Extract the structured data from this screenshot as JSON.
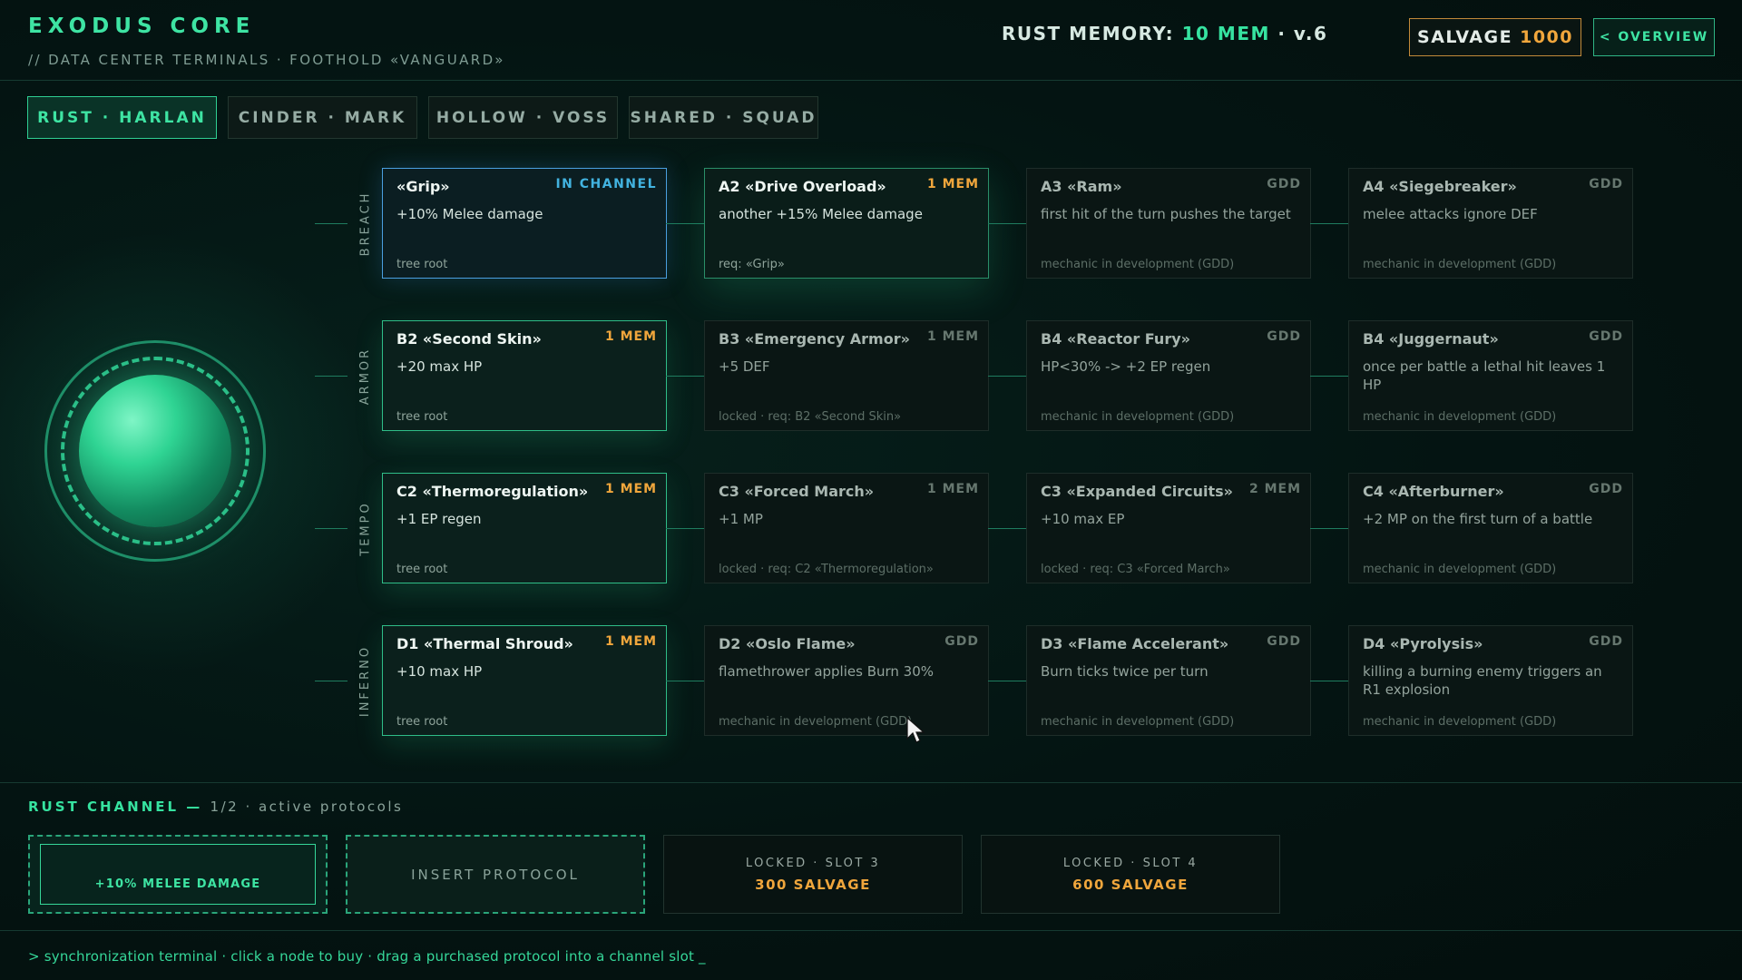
{
  "header": {
    "brand": "EXODUS CORE",
    "subtitle": "// DATA CENTER TERMINALS · FOOTHOLD «VANGUARD»",
    "memory_label": "RUST MEMORY:",
    "memory_value": "10 MEM",
    "version": "· v.6",
    "salvage_label": "SALVAGE",
    "salvage_value": "1000",
    "overview_label": "< OVERVIEW"
  },
  "tabs": [
    {
      "label": "RUST · HARLAN",
      "active": true
    },
    {
      "label": "CINDER · MARK",
      "active": false
    },
    {
      "label": "HOLLOW · VOSS",
      "active": false
    },
    {
      "label": "SHARED · SQUAD",
      "active": false
    }
  ],
  "branches": [
    {
      "label": "BREACH",
      "nodes": [
        {
          "title": "«Grip»",
          "badge": "IN CHANNEL",
          "desc": "+10% Melee damage",
          "foot": "tree root",
          "state": "channel"
        },
        {
          "title": "A2 «Drive Overload»",
          "badge": "1 MEM",
          "desc": "another +15% Melee damage",
          "foot": "req: «Grip»",
          "state": "available"
        },
        {
          "title": "A3 «Ram»",
          "badge": "GDD",
          "desc": "first hit of the turn pushes the target",
          "foot": "mechanic in development (GDD)",
          "state": "gdd"
        },
        {
          "title": "A4 «Siegebreaker»",
          "badge": "GDD",
          "desc": "melee attacks ignore DEF",
          "foot": "mechanic in development (GDD)",
          "state": "gdd"
        }
      ]
    },
    {
      "label": "ARMOR",
      "nodes": [
        {
          "title": "B2 «Second Skin»",
          "badge": "1 MEM",
          "desc": "+20 max HP",
          "foot": "tree root",
          "state": "owned"
        },
        {
          "title": "B3 «Emergency Armor»",
          "badge": "1 MEM",
          "desc": "+5 DEF",
          "foot": "locked · req: B2 «Second Skin»",
          "state": "locked"
        },
        {
          "title": "B4 «Reactor Fury»",
          "badge": "GDD",
          "desc": "HP<30% -> +2 EP regen",
          "foot": "mechanic in development (GDD)",
          "state": "gdd"
        },
        {
          "title": "B4 «Juggernaut»",
          "badge": "GDD",
          "desc": "once per battle a lethal hit leaves 1 HP",
          "foot": "mechanic in development (GDD)",
          "state": "gdd"
        }
      ]
    },
    {
      "label": "TEMPO",
      "nodes": [
        {
          "title": "C2 «Thermoregulation»",
          "badge": "1 MEM",
          "desc": "+1 EP regen",
          "foot": "tree root",
          "state": "owned"
        },
        {
          "title": "C3 «Forced March»",
          "badge": "1 MEM",
          "desc": "+1 MP",
          "foot": "locked · req: C2 «Thermoregulation»",
          "state": "locked"
        },
        {
          "title": "C3 «Expanded Circuits»",
          "badge": "2 MEM",
          "desc": "+10 max EP",
          "foot": "locked · req: C3 «Forced March»",
          "state": "locked"
        },
        {
          "title": "C4 «Afterburner»",
          "badge": "GDD",
          "desc": "+2 MP on the first turn of a battle",
          "foot": "mechanic in development (GDD)",
          "state": "gdd"
        }
      ]
    },
    {
      "label": "INFERNO",
      "nodes": [
        {
          "title": "D1 «Thermal Shroud»",
          "badge": "1 MEM",
          "desc": "+10 max HP",
          "foot": "tree root",
          "state": "owned"
        },
        {
          "title": "D2 «Oslo Flame»",
          "badge": "GDD",
          "desc": "flamethrower applies Burn 30%",
          "foot": "mechanic in development (GDD)",
          "state": "gdd"
        },
        {
          "title": "D3 «Flame Accelerant»",
          "badge": "GDD",
          "desc": "Burn ticks twice per turn",
          "foot": "mechanic in development (GDD)",
          "state": "gdd"
        },
        {
          "title": "D4 «Pyrolysis»",
          "badge": "GDD",
          "desc": "killing a burning enemy triggers an R1 explosion",
          "foot": "mechanic in development (GDD)",
          "state": "gdd"
        }
      ]
    }
  ],
  "channel": {
    "title": "RUST CHANNEL —",
    "title_rest": "1/2 · active protocols",
    "slot1": "+10% MELEE DAMAGE",
    "slot2": "INSERT PROTOCOL",
    "slot3_label": "LOCKED · SLOT 3",
    "slot3_cost": "300 SALVAGE",
    "slot4_label": "LOCKED · SLOT 4",
    "slot4_cost": "600 SALVAGE"
  },
  "console": "> synchronization terminal · click a node to buy · drag a purchased protocol into a channel slot _",
  "colors": {
    "accent": "#3ee4a3",
    "cost": "#f0a63c",
    "channel": "#4a9fe0",
    "background": "#041311"
  }
}
